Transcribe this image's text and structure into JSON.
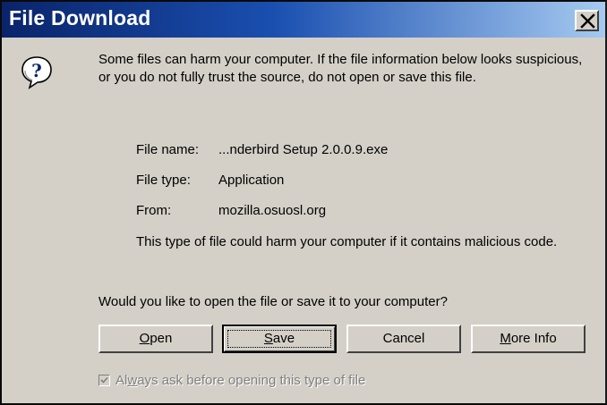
{
  "window": {
    "title": "File Download",
    "close_label": "×"
  },
  "message": "Some files can harm your computer. If the file information below looks suspicious, or you do not fully trust the source, do not open or save this file.",
  "file_info": {
    "name_label": "File name:",
    "name_value": "...nderbird Setup 2.0.0.9.exe",
    "type_label": "File type:",
    "type_value": "Application",
    "from_label": "From:",
    "from_value": "mozilla.osuosl.org"
  },
  "warning": "This type of file could harm your computer if it contains malicious code.",
  "question": "Would you like to open the file or save it to your computer?",
  "buttons": {
    "open": {
      "pre": "",
      "mnemonic": "O",
      "post": "pen"
    },
    "save": {
      "pre": "",
      "mnemonic": "S",
      "post": "ave"
    },
    "cancel": "Cancel",
    "more_info": {
      "pre": "",
      "mnemonic": "M",
      "post": "ore Info"
    }
  },
  "always_ask": {
    "pre": "Al",
    "mnemonic": "w",
    "post": "ays ask before opening this type of file",
    "checked": true,
    "enabled": false
  },
  "colors": {
    "title_gradient_start": "#0a246a",
    "title_gradient_end": "#a6caf0",
    "dialog_face": "#d4d0c8",
    "disabled_text": "#808080"
  },
  "icons": {
    "dialog": "question-icon",
    "close": "close-icon",
    "checkmark": "checkmark-icon"
  }
}
